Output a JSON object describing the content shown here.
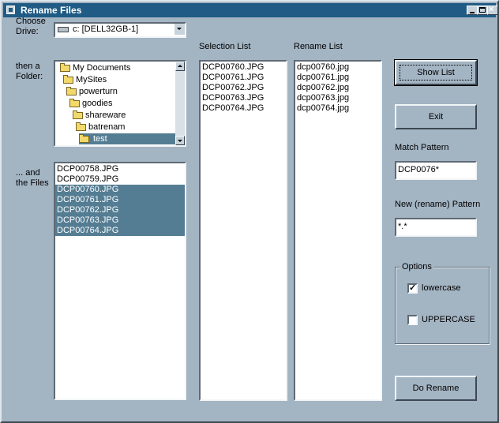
{
  "window": {
    "title": "Rename Files"
  },
  "labels": {
    "choose_drive": "Choose\nDrive:",
    "then_folder": "then a\nFolder:",
    "and_files": "... and\nthe Files",
    "selection_list": "Selection List",
    "rename_list": "Rename List",
    "match_pattern": "Match Pattern",
    "new_pattern": "New (rename) Pattern",
    "options": "Options"
  },
  "drive": {
    "selected": "c: [DELL32GB-1]"
  },
  "folders": [
    {
      "label": "My Documents",
      "indent": 0,
      "selected": false
    },
    {
      "label": "MySites",
      "indent": 1,
      "selected": false
    },
    {
      "label": "powerturn",
      "indent": 2,
      "selected": false
    },
    {
      "label": "goodies",
      "indent": 3,
      "selected": false
    },
    {
      "label": "shareware",
      "indent": 4,
      "selected": false
    },
    {
      "label": "batrenam",
      "indent": 5,
      "selected": false
    },
    {
      "label": "test",
      "indent": 6,
      "selected": true
    }
  ],
  "files": [
    {
      "name": "DCP00758.JPG",
      "selected": false
    },
    {
      "name": "DCP00759.JPG",
      "selected": false
    },
    {
      "name": "DCP00760.JPG",
      "selected": true
    },
    {
      "name": "DCP00761.JPG",
      "selected": true
    },
    {
      "name": "DCP00762.JPG",
      "selected": true
    },
    {
      "name": "DCP00763.JPG",
      "selected": true
    },
    {
      "name": "DCP00764.JPG",
      "selected": true
    }
  ],
  "selection_list": [
    "DCP00760.JPG",
    "DCP00761.JPG",
    "DCP00762.JPG",
    "DCP00763.JPG",
    "DCP00764.JPG"
  ],
  "rename_list": [
    "dcp00760.jpg",
    "dcp00761.jpg",
    "dcp00762.jpg",
    "dcp00763.jpg",
    "dcp00764.jpg"
  ],
  "buttons": {
    "show_list": "Show List",
    "exit": "Exit",
    "do_rename": "Do Rename"
  },
  "match_pattern_value": "DCP0076*",
  "new_pattern_value": "*.*",
  "options": {
    "lowercase": {
      "label": "lowercase",
      "checked": true
    },
    "uppercase": {
      "label": "UPPERCASE",
      "checked": false
    }
  },
  "colors": {
    "selection": "#547d93",
    "titlebar": "#1f5b84",
    "face": "#a3b4c3"
  }
}
